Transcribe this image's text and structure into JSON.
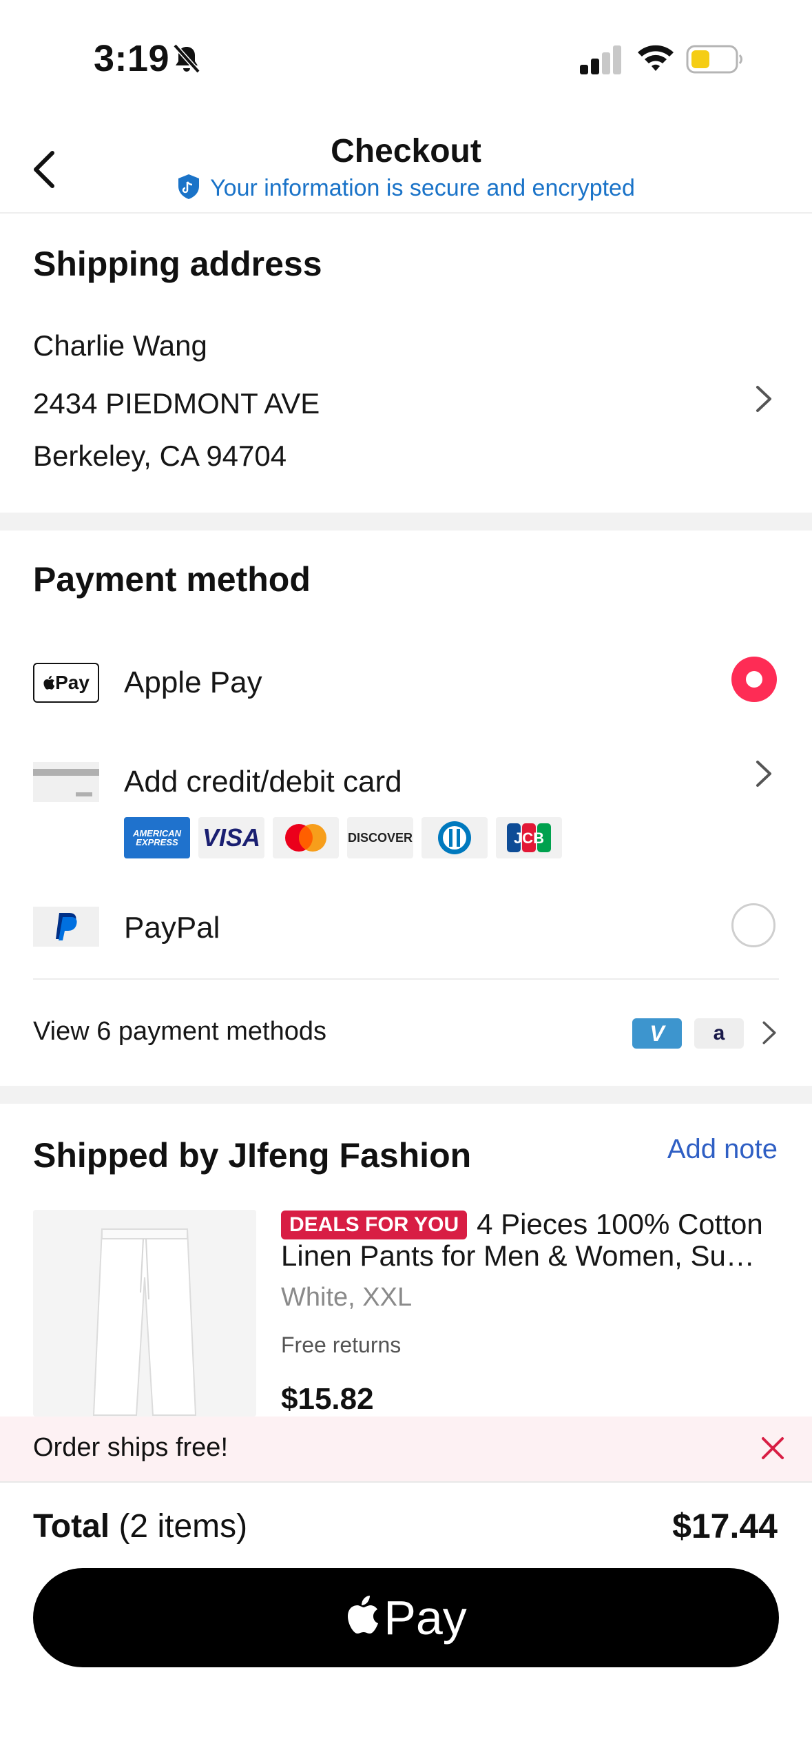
{
  "status_bar": {
    "time": "3:19"
  },
  "header": {
    "title": "Checkout",
    "secure_text": "Your information is secure and encrypted"
  },
  "shipping": {
    "title": "Shipping address",
    "name": "Charlie Wang",
    "street": "2434 PIEDMONT AVE",
    "city_line": "Berkeley, CA 94704"
  },
  "payment": {
    "title": "Payment method",
    "options": [
      {
        "label": "Apple Pay",
        "logo_text": "Pay",
        "selected": true
      },
      {
        "label": "Add credit/debit card",
        "selected": false
      },
      {
        "label": "PayPal",
        "selected": false
      }
    ],
    "card_brands": [
      {
        "name": "amex-logo",
        "text": "AMERICAN EXPRESS"
      },
      {
        "name": "visa-logo",
        "text": "VISA"
      },
      {
        "name": "mastercard-logo",
        "text": ""
      },
      {
        "name": "discover-logo",
        "text": "DISCOVER"
      },
      {
        "name": "diners-logo",
        "text": ""
      },
      {
        "name": "jcb-logo",
        "text": "JCB"
      }
    ],
    "view_more": "View 6 payment methods",
    "mini_logos": {
      "venmo": "V",
      "affirm": "a"
    }
  },
  "shipment": {
    "title": "Shipped by JIfeng Fashion",
    "add_note": "Add note",
    "product": {
      "badge": "DEALS FOR YOU",
      "title": "4 Pieces 100% Cotton Linen Pants for Men & Women, Su…",
      "variant": "White, XXL",
      "returns": "Free returns",
      "price": "$15.82"
    }
  },
  "banner": {
    "text": "Order ships free!"
  },
  "footer": {
    "total_label": "Total",
    "items_count": "(2 items)",
    "total_amount": "$17.44",
    "pay_button_text": "Pay"
  },
  "colors": {
    "accent": "#fe2c55",
    "link_blue": "#2f5fc4",
    "secure_blue": "#1a73c8",
    "deal_red": "#d81e44",
    "banner_bg": "#fdf1f3"
  }
}
